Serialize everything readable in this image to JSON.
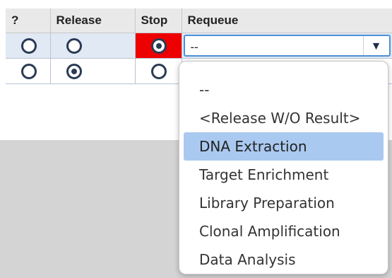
{
  "table": {
    "headers": [
      "?",
      "Release",
      "Stop",
      "Requeue"
    ],
    "rows": [
      {
        "selected": "Stop",
        "requeue_value": "--"
      },
      {
        "selected": "Release",
        "requeue_value": ""
      }
    ]
  },
  "requeue_dropdown": {
    "options": [
      "--",
      "<Release W/O Result>",
      "DNA Extraction",
      "Target Enrichment",
      "Library Preparation",
      "Clonal Amplification",
      "Data Analysis"
    ],
    "highlighted": "DNA Extraction",
    "arrow_icon": "▼"
  },
  "colors": {
    "stop_selected": "#ee0000",
    "release_selected": "#008000",
    "highlight": "#a9c9f0",
    "focus_border": "#4a90d9"
  }
}
